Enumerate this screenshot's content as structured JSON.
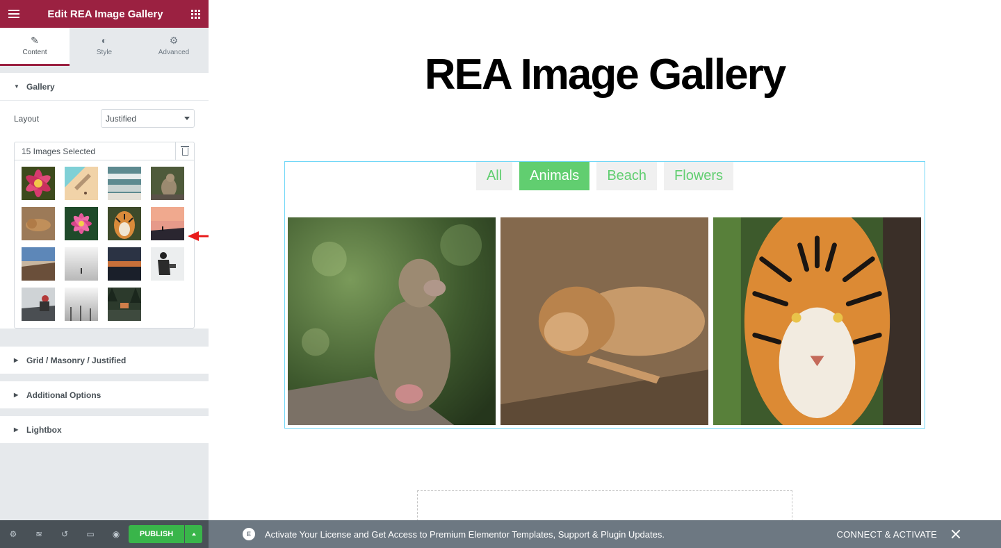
{
  "sidebar": {
    "title": "Edit REA Image Gallery",
    "tabs": [
      {
        "label": "Content",
        "icon": "pencil-icon"
      },
      {
        "label": "Style",
        "icon": "half-circle-icon"
      },
      {
        "label": "Advanced",
        "icon": "gear-icon"
      }
    ],
    "gallery_section": {
      "title": "Gallery",
      "layout_label": "Layout",
      "layout_value": "Justified",
      "images_selected": "15 Images Selected",
      "thumbnail_count": 15
    },
    "sections": [
      {
        "title": "Grid / Masonry / Justified"
      },
      {
        "title": "Additional Options"
      },
      {
        "title": "Lightbox"
      }
    ]
  },
  "footer": {
    "publish_label": "PUBLISH",
    "icons": [
      "settings-icon",
      "layers-icon",
      "history-icon",
      "responsive-icon",
      "preview-icon"
    ]
  },
  "notice": {
    "message": "Activate Your License and Get Access to Premium Elementor Templates, Support & Plugin Updates.",
    "connect_label": "CONNECT & ACTIVATE"
  },
  "preview": {
    "page_title": "REA Image Gallery",
    "filters": [
      {
        "label": "All",
        "active": false
      },
      {
        "label": "Animals",
        "active": true
      },
      {
        "label": "Beach",
        "active": false
      },
      {
        "label": "Flowers",
        "active": false
      }
    ],
    "images": [
      {
        "subject": "baboon"
      },
      {
        "subject": "lion"
      },
      {
        "subject": "tiger"
      }
    ]
  },
  "colors": {
    "brand": "#9b2141",
    "publish_green": "#39b54a",
    "filter_green": "#61ce70",
    "annotation_red": "#e81b1b"
  }
}
